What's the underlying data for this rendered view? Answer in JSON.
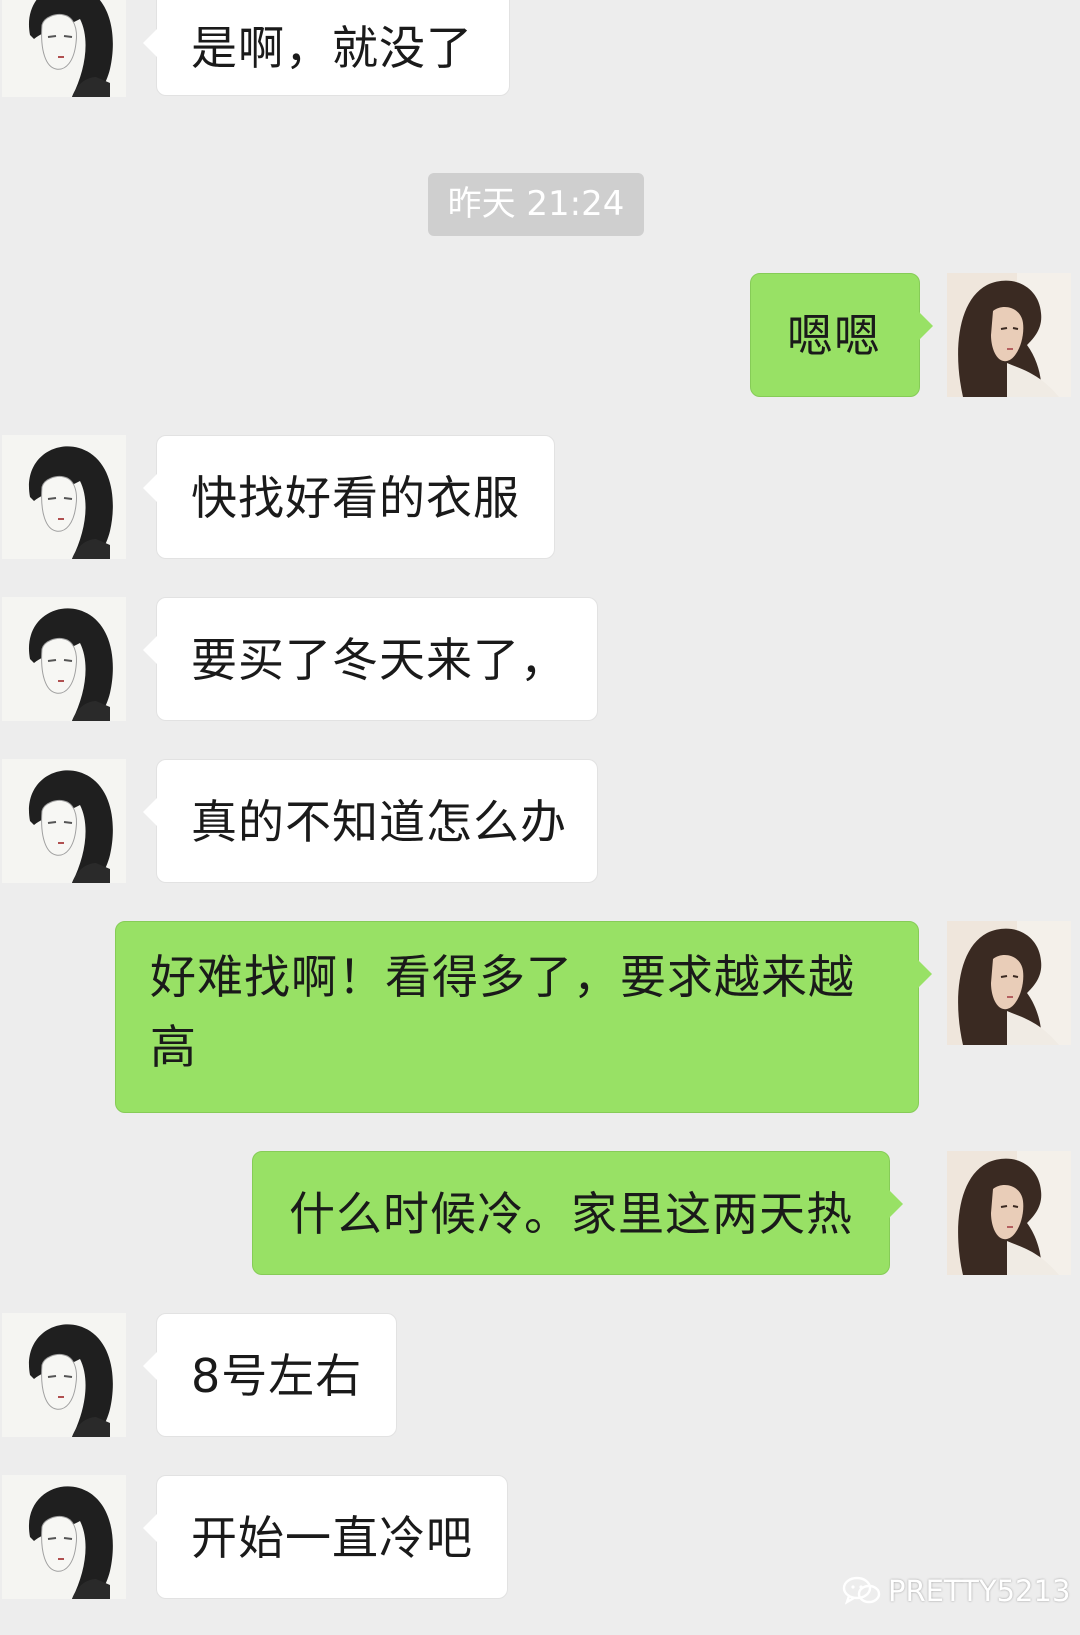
{
  "chat": {
    "messages": [
      {
        "side": "in",
        "text": "是啊，就没了"
      },
      {
        "type": "time",
        "text": "昨天 21:24"
      },
      {
        "side": "out",
        "text": "嗯嗯"
      },
      {
        "side": "in",
        "text": "快找好看的衣服"
      },
      {
        "side": "in",
        "text": "要买了冬天来了，"
      },
      {
        "side": "in",
        "text": "真的不知道怎么办"
      },
      {
        "side": "out",
        "text": "好难找啊！看得多了，要求越来越高"
      },
      {
        "side": "out",
        "text": "什么时候冷。家里这两天热"
      },
      {
        "side": "in",
        "text": "8号左右"
      },
      {
        "side": "in",
        "text": "开始一直冷吧"
      }
    ]
  },
  "watermark": {
    "text": "PRETTY5213",
    "icon": "wechat-icon"
  },
  "colors": {
    "background": "#ededed",
    "incoming_bubble": "#ffffff",
    "outgoing_bubble": "#98e165",
    "timestamp_pill": "#cfcfcf"
  }
}
